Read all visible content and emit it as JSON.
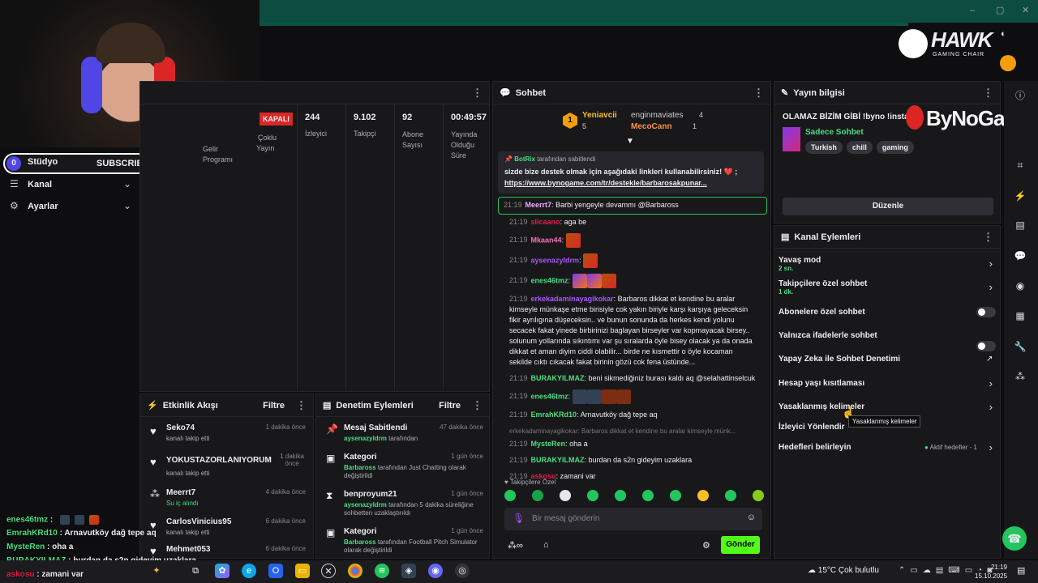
{
  "title_bar": {
    "min": "–",
    "max": "▢",
    "close": "✕"
  },
  "brand": {
    "logo": "HAWK",
    "sub": "GAMING CHAIR",
    "bynogame": "ByNoGame"
  },
  "subs_widget": {
    "left": "0",
    "label": "SUBSCRIBERS",
    "right": "10"
  },
  "left_nav": {
    "studio": "Stüdyo",
    "channel": "Kanal",
    "settings": "Ayarlar"
  },
  "stats": {
    "closed": "KAPALI",
    "income": "Gelir",
    "program": "Programı",
    "multi": "Çoklu",
    "multi2": "Yayın",
    "items": [
      {
        "value": "244",
        "label": "İzleyici"
      },
      {
        "value": "9.102",
        "label": "Takipçi"
      },
      {
        "value": "92",
        "label": "Abone Sayısı"
      },
      {
        "value": "00:49:57",
        "label": "Yayında Olduğu Süre"
      }
    ]
  },
  "activity": {
    "title": "Etkinlik Akışı",
    "filter": "Filtre",
    "items": [
      {
        "name": "Seko74",
        "desc": "kanalı takip etti",
        "time": "1 dakika önce",
        "icon": "heart-icon"
      },
      {
        "name": "YOKUSTAZORLANIYORUM",
        "desc": "kanalı takip etti",
        "time": "1 dakika önce",
        "icon": "heart-icon"
      },
      {
        "name": "Meerrt7",
        "desc": "Su iç alındı",
        "time": "4 dakika önce",
        "icon": "points-icon"
      },
      {
        "name": "CarlosVinicius95",
        "desc": "kanalı takip etti",
        "time": "6 dakika önce",
        "icon": "heart-icon"
      },
      {
        "name": "Mehmet053",
        "desc": "",
        "time": "6 dakika önce",
        "icon": "heart-icon"
      }
    ]
  },
  "moderation": {
    "title": "Denetim Eylemleri",
    "filter": "Filtre",
    "items": [
      {
        "title": "Mesaj Sabitlendi",
        "time": "47 dakika önce",
        "who": "aysenazyldrm",
        "desc": "tarafından"
      },
      {
        "title": "Kategori",
        "time": "1 gün önce",
        "who": "Barbaross",
        "desc": "tarafından Just Chatting olarak değiştirildi"
      },
      {
        "title": "benproyum21",
        "time": "1 gün önce",
        "who": "aysenazyldrm",
        "desc": "tarafından 5 dakika süreliğine sohbetten uzaklaştırıldı"
      },
      {
        "title": "Kategori",
        "time": "1 gün önce",
        "who": "Barbaross",
        "desc": "tarafından Football Pitch Simulator olarak değiştirildi"
      }
    ]
  },
  "chat": {
    "title": "Sohbet",
    "leaders": {
      "rank": "1",
      "first_name": "Yeniavcii",
      "first_count": "5",
      "second_name": "enginmaviates",
      "second_count": "4",
      "third_name": "MecoCann",
      "third_count": "1"
    },
    "pinned": {
      "by": "BotRix",
      "by_suffix": "tarafından sabitlendi",
      "text": "sizde bize destek olmak için aşağıdaki linkleri kullanabilirsiniz! ❤️ ;",
      "link": "https://www.bynogame.com/tr/destekle/barbarosakpunar..."
    },
    "messages": [
      {
        "time": "21:19",
        "user": "Meerrt7",
        "color": "#f0abfc",
        "text": "Barbi yengeyle devammı @Barbaross"
      },
      {
        "time": "21:19",
        "user": "slicaano",
        "color": "#e11d48",
        "text": "aga be"
      },
      {
        "time": "21:19",
        "user": "Mkaan44",
        "color": "#f472b6",
        "text": ""
      },
      {
        "time": "21:19",
        "user": "aysenazyldrm",
        "color": "#a855f7",
        "text": ""
      },
      {
        "time": "21:19",
        "user": "enes46tmz",
        "color": "#4ade80",
        "text": ""
      },
      {
        "time": "21:19",
        "user": "erkekadaminayagikokar",
        "color": "#a855f7",
        "text": "Barbaros dikkat et kendine bu aralar kimseyle münkaşe etme birisiyle cok yakın biriyle karşı karşıya geleceksin fikir ayrılıgına düşeceksin.. ve bunun sonunda da herkes kendi yolunu secacek fakat yinede birbirinizi baglayan birseyler var kopmayacak birsey.. solunum yollarında sıkıntımı var şu sıralarda öyle bisey olacak ya da onada dikkat et aman diyim ciddi olabilir... birde ne kısmettir o öyle kocaman sekilde cıktı cıkacak fakat birinin gözü cok fena üstünde..."
      },
      {
        "time": "21:19",
        "user": "BURAKYILMAZ",
        "color": "#4ade80",
        "text": "beni sikmediğiniz burası kaldı aq @selahattinselcuk"
      },
      {
        "time": "21:19",
        "user": "enes46tmz",
        "color": "#4ade80",
        "text": ""
      },
      {
        "time": "21:19",
        "user": "EmrahKRd10",
        "color": "#4ade80",
        "text": "Arnavutköy dağ tepe aq"
      },
      {
        "time": "21:19",
        "user": "MysteRen",
        "color": "#4ade80",
        "text": "oha a"
      },
      {
        "time": "21:19",
        "user": "BURAKYILMAZ",
        "color": "#4ade80",
        "text": "burdan da s2n gideyim uzaklara"
      },
      {
        "time": "21:19",
        "user": "askosu",
        "color": "#e11d48",
        "text": "zamani var"
      }
    ],
    "reply_preview": "erkekadaminayagikokar: Barbaros dikkat et kendine bu aralar kimseyle münk...",
    "followers_only": "Takipçilere Özel",
    "input_placeholder": "Bir mesaj gönderin",
    "send": "Gönder"
  },
  "stream_info": {
    "title": "Yayın bilgisi",
    "stream_title": "OLAMAZ BİZİM GİBİ !byno !insta",
    "category": "Sadece Sohbet",
    "tags": [
      "Turkish",
      "chill",
      "gaming"
    ],
    "edit": "Düzenle"
  },
  "channel_actions": {
    "title": "Kanal Eylemleri",
    "items": [
      {
        "label": "Yavaş mod",
        "sub": "2 sn.",
        "type": "chevron"
      },
      {
        "label": "Takipçilere özel sohbet",
        "sub": "1 dk.",
        "type": "chevron"
      },
      {
        "label": "Abonelere özel sohbet",
        "sub": "",
        "type": "toggle"
      },
      {
        "label": "Yalnızca ifadelerle sohbet",
        "sub": "",
        "type": "toggle"
      },
      {
        "label": "Yapay Zeka ile Sohbet Denetimi",
        "sub": "",
        "type": "external"
      },
      {
        "label": "Hesap yaşı kısıtlaması",
        "sub": "",
        "type": "chevron"
      },
      {
        "label": "Yasaklanmış kelimeler",
        "sub": "",
        "type": "chevron"
      },
      {
        "label": "İzleyici Yönlendir",
        "sub": "",
        "type": "none"
      },
      {
        "label": "Hedefleri belirleyin",
        "sub": "",
        "type": "chevron"
      }
    ],
    "tooltip": "Yasaklanmış kelimeler",
    "active_goals": "Aktif hedefler - 1"
  },
  "overlay_chat": [
    {
      "user": "enes46tmz",
      "color": "#4ade80",
      "text": ""
    },
    {
      "user": "EmrahKRd10",
      "color": "#4ade80",
      "text": "Arnavutköy dağ tepe aq"
    },
    {
      "user": "MysteRen",
      "color": "#4ade80",
      "text": "oha a"
    },
    {
      "user": "BURAKYILMAZ",
      "color": "#4ade80",
      "text": "burdan da s2n gideyim uzaklara"
    },
    {
      "user": "askosu",
      "color": "#e11d48",
      "text": "zamani var"
    }
  ],
  "taskbar": {
    "weather": "15°C  Çok bulutlu",
    "time": "21:19",
    "date": "15.10.2025"
  }
}
